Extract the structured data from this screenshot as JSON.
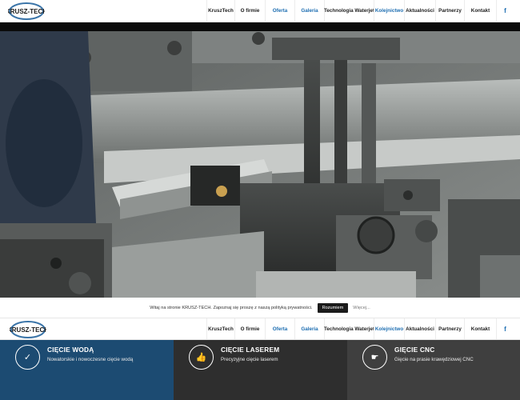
{
  "brand": {
    "logo_text": "KRUSZ-TECH"
  },
  "nav": {
    "items": [
      {
        "label": "KruszTech",
        "active": false
      },
      {
        "label": "O firmie",
        "active": false
      },
      {
        "label": "Oferta",
        "active": true
      },
      {
        "label": "Galeria",
        "active": true
      },
      {
        "label": "Technologia Waterjet",
        "active": false
      },
      {
        "label": "Kolejnictwo",
        "active": true
      },
      {
        "label": "Aktualności",
        "active": false
      },
      {
        "label": "Partnerzy",
        "active": false
      },
      {
        "label": "Kontakt",
        "active": false
      }
    ],
    "facebook_glyph": "f",
    "facebook_icon": "facebook-icon"
  },
  "hero": {
    "image": "press-brake-machine-photo"
  },
  "cookie": {
    "message": "Witaj na stronie KRUSZ-TECH. Zapoznaj się proszę z naszą polityką prywatności.",
    "accept_label": "Rozumiem",
    "more_label": "Więcej..."
  },
  "features": [
    {
      "title": "CIĘCIE WODĄ",
      "desc": "Nowatorskie i nowoczesne cięcie wodą",
      "icon": "checkmark-icon",
      "glyph": "✓"
    },
    {
      "title": "CIĘCIE LASEREM",
      "desc": "Precyzyjne cięcie laserem",
      "icon": "thumbs-up-icon",
      "glyph": "👍"
    },
    {
      "title": "GIĘCIE CNC",
      "desc": "Gięcie na prasie krawędziowej CNC",
      "icon": "hand-pointing-icon",
      "glyph": "☛"
    }
  ],
  "colors": {
    "accent": "#1f6fb2",
    "feature1": "#1c4b72",
    "feature2": "#2e2e2e",
    "feature3": "#3f3f3f"
  }
}
